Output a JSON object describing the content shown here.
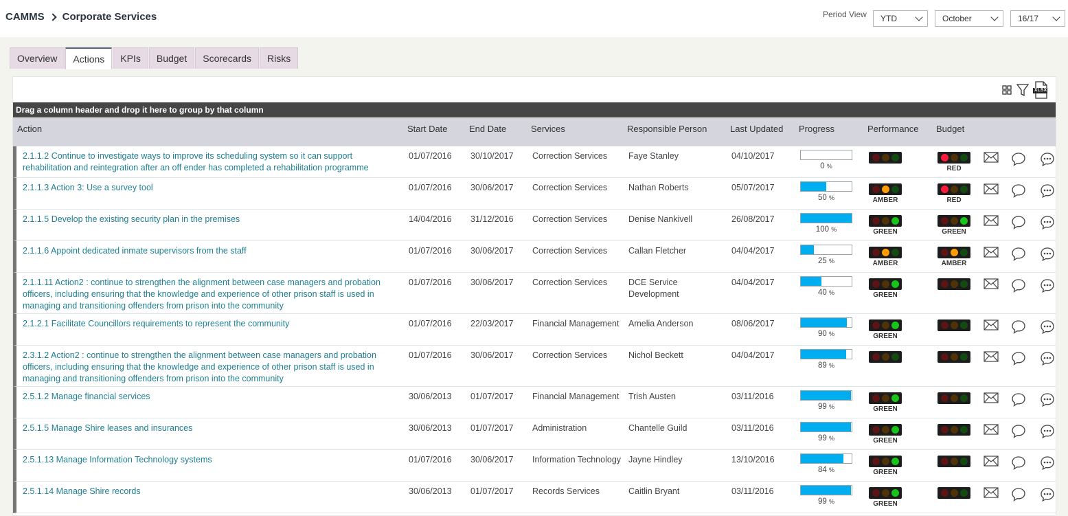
{
  "breadcrumb": {
    "root": "CAMMS",
    "current": "Corporate Services"
  },
  "period": {
    "label": "Period View",
    "view": "YTD",
    "month": "October",
    "year": "16/17"
  },
  "tabs": [
    {
      "label": "Overview",
      "active": false
    },
    {
      "label": "Actions",
      "active": true
    },
    {
      "label": "KPIs",
      "active": false
    },
    {
      "label": "Budget",
      "active": false
    },
    {
      "label": "Scorecards",
      "active": false
    },
    {
      "label": "Risks",
      "active": false
    }
  ],
  "toolbar": {
    "xlsx_label": "XLSX"
  },
  "grid": {
    "group_hint": "Drag a column header and drop it here to group by that column",
    "columns": {
      "action": "Action",
      "start": "Start Date",
      "end": "End Date",
      "services": "Services",
      "responsible": "Responsible Person",
      "updated": "Last Updated",
      "progress": "Progress",
      "performance": "Performance",
      "budget": "Budget"
    },
    "percent_sign": "%",
    "rows": [
      {
        "action": "2.1.1.2 Continue to investigate ways to improve its scheduling system so it can support rehabilitation and reintegration after an off ender has completed a rehabilitation programme",
        "start": "01/07/2016",
        "end": "30/10/2017",
        "services": "Correction Services",
        "responsible": "Faye Stanley",
        "updated": "04/10/2017",
        "progress": 0,
        "perf_status": "",
        "budget_status": "RED"
      },
      {
        "action": "2.1.1.3 Action 3: Use a survey tool",
        "start": "01/07/2016",
        "end": "30/06/2017",
        "services": "Correction Services",
        "responsible": "Nathan Roberts",
        "updated": "05/07/2017",
        "progress": 50,
        "perf_status": "AMBER",
        "budget_status": "RED"
      },
      {
        "action": "2.1.1.5 Develop the existing security plan in the premises",
        "start": "14/04/2016",
        "end": "31/12/2016",
        "services": "Correction Services",
        "responsible": "Denise Nankivell",
        "updated": "26/08/2017",
        "progress": 100,
        "perf_status": "GREEN",
        "budget_status": "GREEN"
      },
      {
        "action": "2.1.1.6 Appoint dedicated inmate supervisors from the staff",
        "start": "01/07/2016",
        "end": "30/06/2017",
        "services": "Correction Services",
        "responsible": "Callan Fletcher",
        "updated": "04/04/2017",
        "progress": 25,
        "perf_status": "AMBER",
        "budget_status": "AMBER"
      },
      {
        "action": "2.1.1.11 Action2 : continue to strengthen the alignment between case managers and probation officers, including ensuring that the knowledge and experience of other prison staff is used in managing and transitioning offenders from prison into the community",
        "start": "01/07/2016",
        "end": "30/06/2017",
        "services": "Correction Services",
        "responsible": "DCE Service Development",
        "updated": "04/04/2017",
        "progress": 40,
        "perf_status": "GREEN",
        "budget_status": ""
      },
      {
        "action": "2.1.2.1 Facilitate Councillors requirements to represent the community",
        "start": "01/07/2016",
        "end": "22/03/2017",
        "services": "Financial Management",
        "responsible": "Amelia Anderson",
        "updated": "08/06/2017",
        "progress": 90,
        "perf_status": "GREEN",
        "budget_status": ""
      },
      {
        "action": "2.3.1.2 Action2 : continue to strengthen the alignment between case managers and probation officers, including ensuring that the knowledge and experience of other prison staff is used in managing and transitioning offenders from prison into the community",
        "start": "01/07/2016",
        "end": "30/06/2017",
        "services": "Correction Services",
        "responsible": "Nichol Beckett",
        "updated": "04/04/2017",
        "progress": 89,
        "perf_status": "",
        "budget_status": ""
      },
      {
        "action": "2.5.1.2 Manage financial services",
        "start": "30/06/2013",
        "end": "01/07/2017",
        "services": "Financial Management",
        "responsible": "Trish Austen",
        "updated": "03/11/2016",
        "progress": 99,
        "perf_status": "GREEN",
        "budget_status": ""
      },
      {
        "action": "2.5.1.5 Manage Shire leases and insurances",
        "start": "30/06/2013",
        "end": "01/07/2017",
        "services": "Administration",
        "responsible": "Chantelle Guild",
        "updated": "03/11/2016",
        "progress": 99,
        "perf_status": "GREEN",
        "budget_status": ""
      },
      {
        "action": "2.5.1.13 Manage Information Technology systems",
        "start": "01/07/2016",
        "end": "30/06/2017",
        "services": "Information Technology",
        "responsible": "Jayne Hindley",
        "updated": "13/10/2016",
        "progress": 84,
        "perf_status": "GREEN",
        "budget_status": ""
      },
      {
        "action": "2.5.1.14 Manage Shire records",
        "start": "30/06/2013",
        "end": "01/07/2017",
        "services": "Records Services",
        "responsible": "Caitlin Bryant",
        "updated": "03/11/2016",
        "progress": 99,
        "perf_status": "GREEN",
        "budget_status": ""
      }
    ]
  },
  "colors": {
    "accent": "#00adef",
    "link": "#1f7f93",
    "header": "#d5d5dd",
    "groupbar": "#464646",
    "tab": "#e6dbe4"
  },
  "icons": [
    "chevron-right-icon",
    "chevron-down-icon",
    "grid-view-icon",
    "filter-icon",
    "xlsx-export-icon",
    "mail-icon",
    "comment-icon",
    "more-comments-icon"
  ]
}
